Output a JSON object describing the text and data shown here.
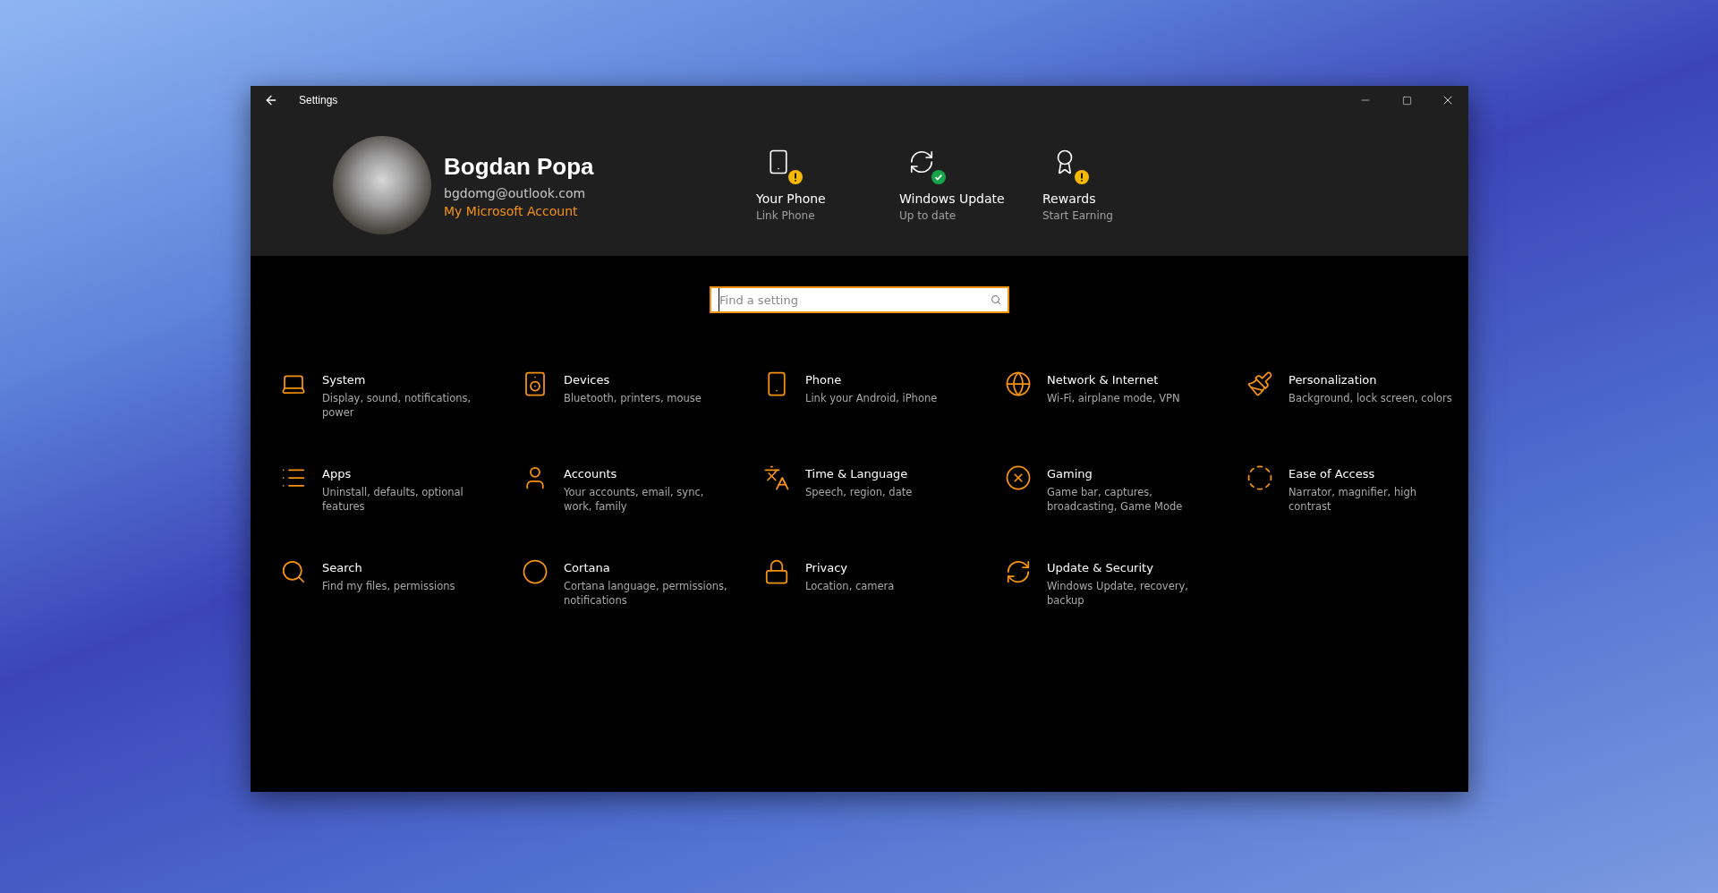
{
  "window": {
    "title": "Settings"
  },
  "account": {
    "name": "Bogdan Popa",
    "email": "bgdomg@outlook.com",
    "link": "My Microsoft Account"
  },
  "hero_items": [
    {
      "title": "Your Phone",
      "subtitle": "Link Phone",
      "kind": "warning"
    },
    {
      "title": "Windows Update",
      "subtitle": "Up to date",
      "kind": "ok"
    },
    {
      "title": "Rewards",
      "subtitle": "Start Earning",
      "kind": "warning"
    }
  ],
  "search": {
    "placeholder": "Find a setting",
    "focused": true
  },
  "categories": [
    {
      "title": "System",
      "description": "Display, sound, notifications, power"
    },
    {
      "title": "Devices",
      "description": "Bluetooth, printers, mouse"
    },
    {
      "title": "Phone",
      "description": "Link your Android, iPhone"
    },
    {
      "title": "Network & Internet",
      "description": "Wi-Fi, airplane mode, VPN"
    },
    {
      "title": "Personalization",
      "description": "Background, lock screen, colors"
    },
    {
      "title": "Apps",
      "description": "Uninstall, defaults, optional features"
    },
    {
      "title": "Accounts",
      "description": "Your accounts, email, sync, work, family"
    },
    {
      "title": "Time & Language",
      "description": "Speech, region, date"
    },
    {
      "title": "Gaming",
      "description": "Game bar, captures, broadcasting, Game Mode"
    },
    {
      "title": "Ease of Access",
      "description": "Narrator, magnifier, high contrast"
    },
    {
      "title": "Search",
      "description": "Find my files, permissions"
    },
    {
      "title": "Cortana",
      "description": "Cortana language, permissions, notifications"
    },
    {
      "title": "Privacy",
      "description": "Location, camera"
    },
    {
      "title": "Update & Security",
      "description": "Windows Update, recovery, backup"
    }
  ]
}
